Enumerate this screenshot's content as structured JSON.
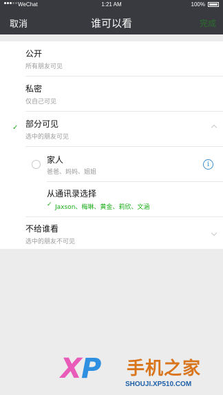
{
  "status_bar": {
    "carrier": "WeChat",
    "time": "1:21 AM",
    "battery": "100%"
  },
  "nav": {
    "cancel": "取消",
    "title": "谁可以看",
    "done": "完成"
  },
  "options": [
    {
      "title": "公开",
      "subtitle": "所有朋友可见"
    },
    {
      "title": "私密",
      "subtitle": "仅自己可见"
    },
    {
      "title": "部分可见",
      "subtitle": "选中的朋友可见",
      "checked": true
    },
    {
      "title": "不给谁看",
      "subtitle": "选中的朋友不可见"
    }
  ],
  "partial": {
    "group": {
      "title": "家人",
      "members": "爸爸、妈妈、姐姐"
    },
    "contacts": {
      "title": "从通讯录选择",
      "selected": "Jaxson、梅琳、黄金、莉欣、文涵"
    }
  },
  "watermark": {
    "brand_en": "SHOUJI.XP510.COM",
    "brand_cn": "手机之家",
    "logo_x": "X",
    "logo_p": "P"
  },
  "colors": {
    "accent": "#1aad19",
    "navbar": "#393a3f",
    "info": "#3b8fd0"
  }
}
